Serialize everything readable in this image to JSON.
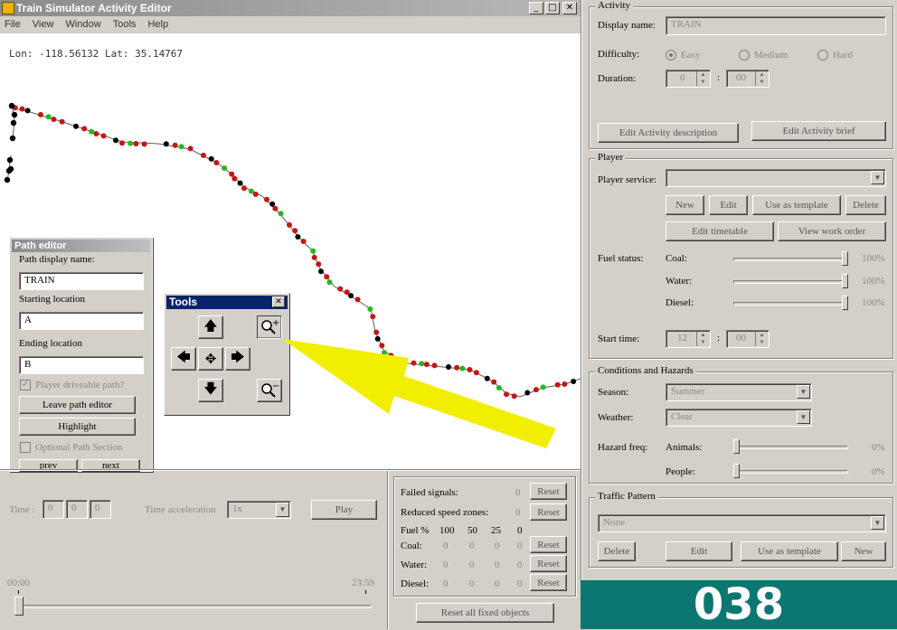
{
  "window": {
    "title": "Train Simulator Activity Editor",
    "controls": [
      "_",
      "□",
      "✕"
    ]
  },
  "menu": [
    "File",
    "View",
    "Window",
    "Tools",
    "Help"
  ],
  "map": {
    "coords": "Lon: -118.56132 Lat: 35.14767"
  },
  "path_editor": {
    "title": "Path editor",
    "display_name_label": "Path display name:",
    "display_name_value": "TRAIN",
    "starting_label": "Starting location",
    "starting_value": "A",
    "ending_label": "Ending location",
    "ending_value": "B",
    "driveable_label": "Player driveable path?",
    "driveable_checked": true,
    "leave_button": "Leave path editor",
    "highlight_button": "Highlight",
    "optional_label": "Optional Path Section",
    "prev_button": "prev",
    "next_button": "next"
  },
  "tools": {
    "title": "Tools",
    "close": "✕",
    "up": "🡅",
    "down": "🡇",
    "left": "🡄",
    "right": "🡆",
    "center": "✥",
    "zoom_in": "+",
    "zoom_out": "−"
  },
  "timeline": {
    "time_label": "Time :",
    "time_fields": [
      "0",
      "0",
      "0"
    ],
    "acceleration_label": "Time acceleration",
    "acceleration_value": "1x",
    "play_button": "Play",
    "start_time": "00:00",
    "end_time": "23:59",
    "position": 0.0
  },
  "failures": {
    "failed_signals_label": "Failed signals:",
    "failed_signals_value": "0",
    "reduced_speed_label": "Reduced speed zones:",
    "reduced_speed_value": "0",
    "reset": "Reset",
    "fuel_header_label": "Fuel %",
    "fuel_columns": [
      "100",
      "50",
      "25",
      "0"
    ],
    "rows": [
      {
        "label": "Coal:",
        "values": [
          "0",
          "0",
          "0",
          "0"
        ]
      },
      {
        "label": "Water:",
        "values": [
          "0",
          "0",
          "0",
          "0"
        ]
      },
      {
        "label": "Diesel:",
        "values": [
          "0",
          "0",
          "0",
          "0"
        ]
      }
    ],
    "reset_all_button": "Reset all fixed objects"
  },
  "activity": {
    "title": "Activity",
    "display_name_label": "Display name:",
    "display_name_value": "TRAIN",
    "difficulty_label": "Difficulty:",
    "difficulty_options": [
      "Easy",
      "Medium",
      "Hard"
    ],
    "difficulty_selected": "Easy",
    "duration_label": "Duration:",
    "duration_hours": "0",
    "duration_minutes": "00",
    "colon": ":",
    "edit_description_button": "Edit Activity description",
    "edit_brief_button": "Edit Activity brief"
  },
  "player": {
    "title": "Player",
    "service_label": "Player service:",
    "service_value": "",
    "new_button": "New",
    "edit_button": "Edit",
    "template_button": "Use as template",
    "delete_button": "Delete",
    "timetable_button": "Edit timetable",
    "work_order_button": "View work order",
    "fuel_label": "Fuel status:",
    "fuel": [
      {
        "label": "Coal:",
        "value": "100%",
        "level": 1.0
      },
      {
        "label": "Water:",
        "value": "100%",
        "level": 1.0
      },
      {
        "label": "Diesel:",
        "value": "100%",
        "level": 1.0
      }
    ],
    "start_time_label": "Start time:",
    "start_hours": "12",
    "start_minutes": "00",
    "colon": ":"
  },
  "conditions": {
    "title": "Conditions and Hazards",
    "season_label": "Season:",
    "season_value": "Summer",
    "weather_label": "Weather:",
    "weather_value": "Clear",
    "hazard_label": "Hazard freq:",
    "hazards": [
      {
        "label": "Animals:",
        "value": "0%",
        "level": 0.0
      },
      {
        "label": "People:",
        "value": "0%",
        "level": 0.0
      }
    ]
  },
  "traffic": {
    "title": "Traffic Pattern",
    "value": "None",
    "delete_button": "Delete",
    "edit_button": "Edit",
    "template_button": "Use as template",
    "new_button": "New"
  },
  "badge": "038",
  "colors": {
    "track": "#606060",
    "marker_red": "#c81414",
    "marker_green": "#22b822",
    "marker_black": "#000000",
    "arrow": "#f2ee00",
    "badge_bg": "#0b7770",
    "tools_title": "#0a246a"
  }
}
